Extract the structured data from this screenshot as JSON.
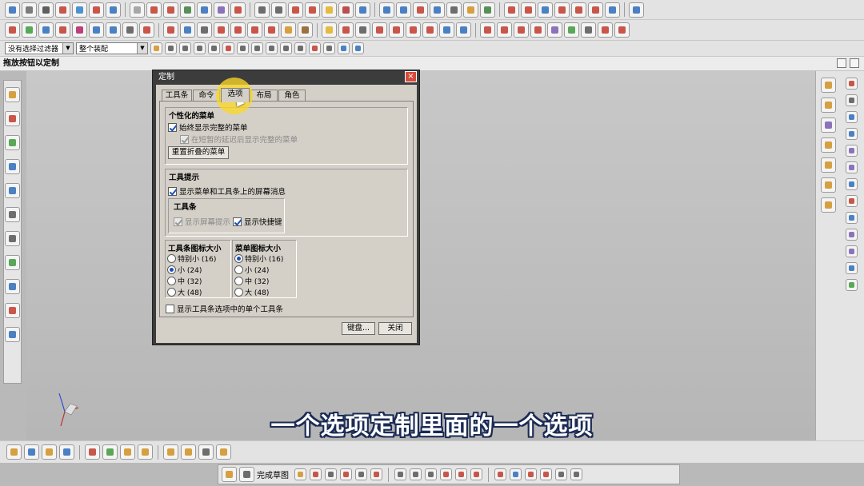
{
  "toolbars": {
    "row1_colors": [
      "#2b6cb8",
      "#666",
      "#444",
      "#c0392b",
      "#2f80c8",
      "#c0392b",
      "#2b6cb8",
      "#999",
      "#c0392b",
      "#c0392b",
      "#3c7d3c",
      "#2b6cb8",
      "#7a5ab0",
      "#c0392b",
      "#555",
      "#555",
      "#c0392b",
      "#c0392b",
      "#e0b020",
      "#b03030",
      "#2b6cb8",
      "#2b6cb8",
      "#2b6cb8",
      "#c0392b",
      "#2b6cb8",
      "#555",
      "#d09020",
      "#3c7d3c",
      "#c0392b",
      "#c0392b",
      "#2b6cb8",
      "#c0392b",
      "#c0392b",
      "#c0392b",
      "#2b6cb8",
      "#2b6cb8"
    ],
    "row2_colors": [
      "#c0392b",
      "#3c9a3c",
      "#2b6cb8",
      "#c0392b",
      "#b02060",
      "#2b6cb8",
      "#2b6cb8",
      "#555",
      "#c0392b",
      "#c0392b",
      "#2b6cb8",
      "#555",
      "#c0392b",
      "#c0392b",
      "#c0392b",
      "#c0392b",
      "#d09020",
      "#8a5a20",
      "#e0b020",
      "#c0392b",
      "#555",
      "#c0392b",
      "#c0392b",
      "#c0392b",
      "#c0392b",
      "#2b6cb8",
      "#2b6cb8",
      "#c0392b",
      "#c0392b",
      "#c0392b",
      "#c0392b",
      "#7a5ab0",
      "#3c9a3c",
      "#555",
      "#c0392b",
      "#c0392b"
    ],
    "filter_combo": "没有选择过滤器",
    "assembly_combo": "整个装配",
    "row3_colors": [
      "#d09020",
      "#555",
      "#555",
      "#555",
      "#555",
      "#c0392b",
      "#555",
      "#555",
      "#555",
      "#555",
      "#555",
      "#c0392b",
      "#555",
      "#2b6cb8",
      "#2b6cb8"
    ]
  },
  "cue_line": "拖放按钮以定制",
  "dialog": {
    "title": "定制",
    "close": "×",
    "tabs": [
      "工具条",
      "命令",
      "选项",
      "布局",
      "角色"
    ],
    "active_tab": "选项",
    "personal_menu": {
      "title": "个性化的菜单",
      "always_full": "始终显示完整的菜单",
      "delay_full": "在短暂的延迟后显示完整的菜单",
      "reset_button": "重置折叠的菜单"
    },
    "tooltips": {
      "title": "工具提示",
      "show_screen_tips": "显示菜单和工具条上的屏幕消息",
      "toolbar_title": "工具条",
      "screen_tips": "显示屏幕提示",
      "shortcuts": "显示快捷键"
    },
    "toolbar_icon_size": {
      "title": "工具条图标大小",
      "options": [
        "特别小 (16)",
        "小 (24)",
        "中 (32)",
        "大 (48)"
      ],
      "selected": 1
    },
    "menu_icon_size": {
      "title": "菜单图标大小",
      "options": [
        "特别小 (16)",
        "小 (24)",
        "中 (32)",
        "大 (48)"
      ],
      "selected": 0
    },
    "single_toolbar": "显示工具条选项中的单个工具条",
    "keyboard_button": "键盘...",
    "close_button": "关闭"
  },
  "resource_bar": {
    "left_colors": [
      "#d09020",
      "#c0392b",
      "#3c9a3c",
      "#2b6cb8",
      "#2b6cb8",
      "#555",
      "#555",
      "#3c9a3c",
      "#2b6cb8",
      "#c0392b",
      "#2b6cb8"
    ],
    "right_a_colors": [
      "#d09020",
      "#d09020",
      "#7a5ab0",
      "#d09020",
      "#d09020",
      "#d09020",
      "#d09020"
    ],
    "right_b_colors": [
      "#c0392b",
      "#555",
      "#2b6cb8",
      "#2b6cb8",
      "#7a5ab0",
      "#7a5ab0",
      "#2b6cb8",
      "#c0392b",
      "#2b6cb8",
      "#7a5ab0",
      "#7a5ab0",
      "#2b6cb8",
      "#3c9a3c"
    ]
  },
  "bottom_toolbar": {
    "colors": [
      "#d09020",
      "#2b6cb8",
      "#d09020",
      "#2b6cb8",
      "#c0392b",
      "#3c9a3c",
      "#d09020",
      "#d09020",
      "#d09020",
      "#d09020",
      "#555",
      "#d09020"
    ]
  },
  "sketch_bar": {
    "finish_label": "完成草图",
    "colors": [
      "#d09020",
      "#c0392b",
      "#555",
      "#c0392b",
      "#555",
      "#c0392b",
      "#555",
      "#555",
      "#555",
      "#c0392b",
      "#c0392b",
      "#c0392b",
      "#c0392b",
      "#2b6cb8",
      "#c0392b",
      "#c0392b",
      "#555",
      "#555"
    ]
  },
  "subtitle": "一个选项定制里面的一个选项"
}
